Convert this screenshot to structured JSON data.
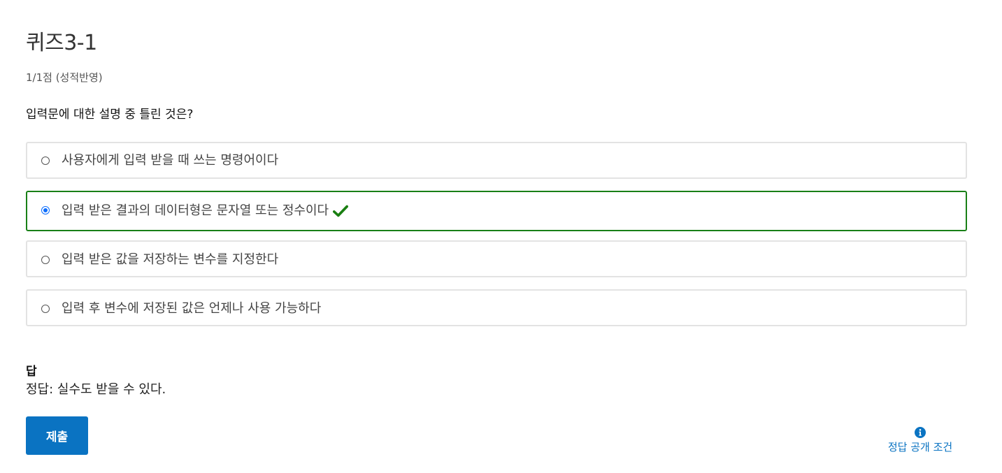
{
  "quiz": {
    "title": "퀴즈3-1",
    "score": "1/1점 (성적반영)",
    "question": "입력문에 대한 설명 중 틀린 것은?"
  },
  "options": [
    {
      "label": "사용자에게 입력 받을 때 쓰는 명령어이다",
      "selected": false,
      "correct": false
    },
    {
      "label": "입력 받은 결과의 데이터형은 문자열 또는 정수이다",
      "selected": true,
      "correct": true
    },
    {
      "label": "입력 받은 값을 저장하는 변수를 지정한다",
      "selected": false,
      "correct": false
    },
    {
      "label": "입력 후 변수에 저장된 값은 언제나 사용 가능하다",
      "selected": false,
      "correct": false
    }
  ],
  "answer": {
    "heading": "답",
    "text": "정답:  실수도 받을 수 있다."
  },
  "actions": {
    "submit_label": "제출",
    "reveal_label": "정답 공개 조건"
  },
  "icons": {
    "check": "check-icon",
    "info": "info-icon"
  },
  "colors": {
    "correct_border": "#198017",
    "check": "#1a7f12",
    "primary": "#0a73c2",
    "radio_selected": "#0d6efd"
  }
}
